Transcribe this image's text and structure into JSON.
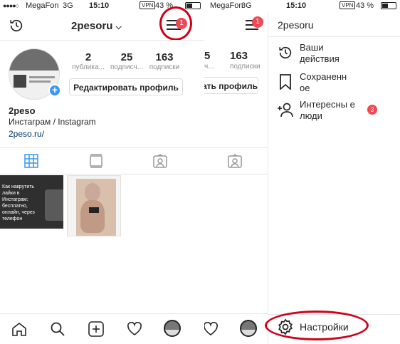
{
  "status": {
    "carrier": "MegaFon",
    "network": "3G",
    "time": "15:10",
    "vpn": "VPN",
    "battery": "43 %"
  },
  "left": {
    "username": "2pesoru",
    "menu_badge": "1",
    "stats": [
      {
        "value": "2",
        "label": "публика..."
      },
      {
        "value": "25",
        "label": "подписч..."
      },
      {
        "value": "163",
        "label": "подписки"
      }
    ],
    "edit_profile_label": "Редактировать профиль",
    "name": "2peso",
    "bio": "Инстаграм / Instagram",
    "link": "2peso.ru/",
    "post1_caption": "Как накрутить лайки в Инстаграм: бесплатно, онлайн, через телефон"
  },
  "right": {
    "username": "2pesoru",
    "menu_badge": "1",
    "partial_stats": [
      {
        "value": "5"
      },
      {
        "value": "163"
      }
    ],
    "partial_stat_labels": [
      "ч...",
      "подписки"
    ],
    "partial_edit_label": "ать профиль",
    "drawer_title": "2pesoru",
    "menu": [
      {
        "label": "Ваши действия",
        "icon": "activity-history-icon"
      },
      {
        "label": "Сохраненн ое",
        "icon": "bookmark-icon"
      },
      {
        "label": "Интересны е люди",
        "icon": "add-person-icon",
        "badge": "3"
      }
    ],
    "settings_label": "Настройки"
  },
  "colors": {
    "accent_blue": "#3897f0",
    "badge_red": "#ed4956",
    "highlight_ring": "#d0021b",
    "link": "#003569"
  }
}
